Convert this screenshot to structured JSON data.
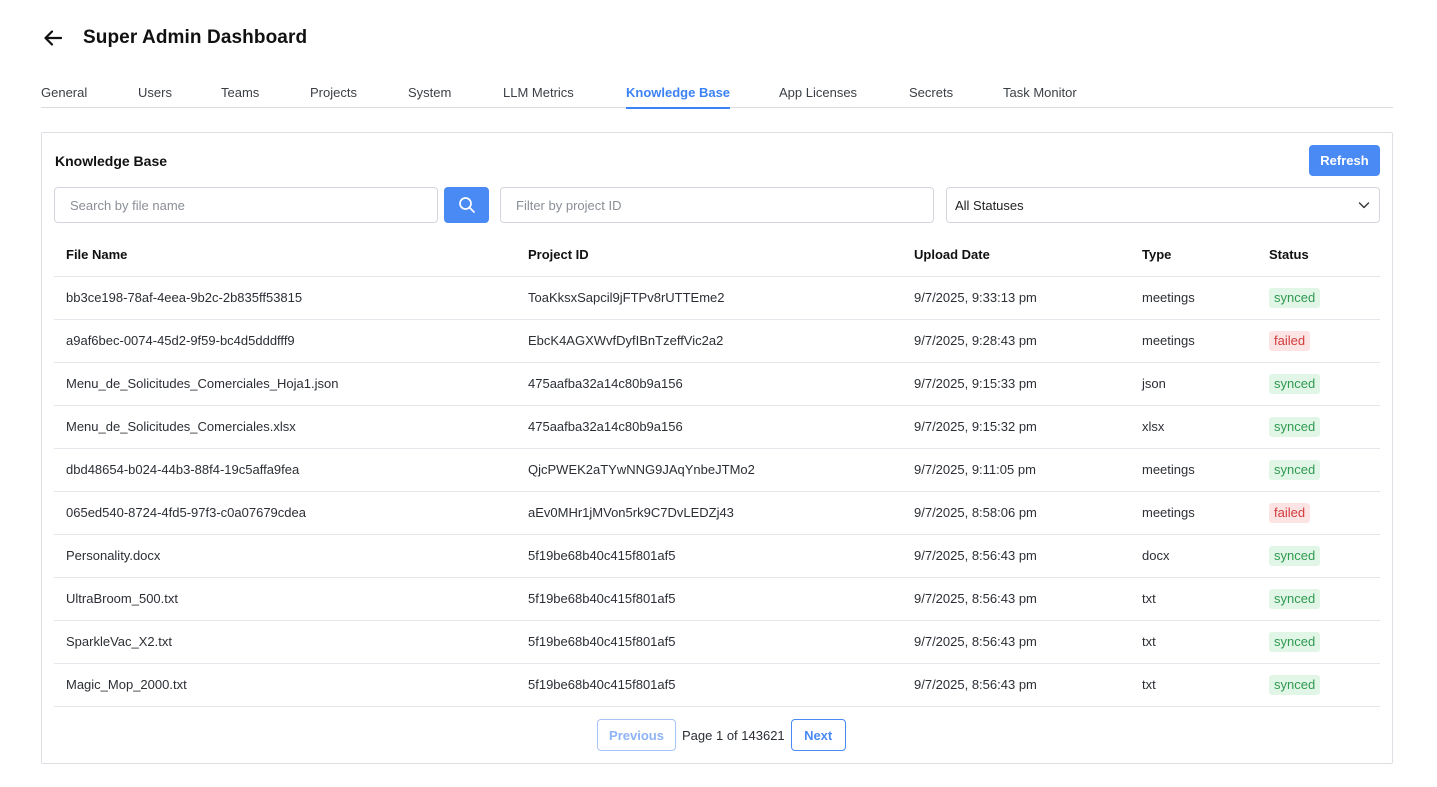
{
  "header": {
    "title": "Super Admin Dashboard"
  },
  "tabs": [
    {
      "label": "General"
    },
    {
      "label": "Users"
    },
    {
      "label": "Teams"
    },
    {
      "label": "Projects"
    },
    {
      "label": "System"
    },
    {
      "label": "LLM Metrics"
    },
    {
      "label": "Knowledge Base",
      "active": true
    },
    {
      "label": "App Licenses"
    },
    {
      "label": "Secrets"
    },
    {
      "label": "Task Monitor"
    }
  ],
  "card": {
    "title": "Knowledge Base",
    "refresh_label": "Refresh",
    "search_placeholder": "Search by file name",
    "project_placeholder": "Filter by project ID",
    "status_value": "All Statuses"
  },
  "table": {
    "columns": [
      "File Name",
      "Project ID",
      "Upload Date",
      "Type",
      "Status"
    ],
    "rows": [
      [
        "bb3ce198-78af-4eea-9b2c-2b835ff53815",
        "ToaKksxSapcil9jFTPv8rUTTEme2",
        "9/7/2025, 9:33:13 pm",
        "meetings",
        "synced"
      ],
      [
        "a9af6bec-0074-45d2-9f59-bc4d5dddfff9",
        "EbcK4AGXWvfDyfIBnTzeffVic2a2",
        "9/7/2025, 9:28:43 pm",
        "meetings",
        "failed"
      ],
      [
        "Menu_de_Solicitudes_Comerciales_Hoja1.json",
        "475aafba32a14c80b9a156",
        "9/7/2025, 9:15:33 pm",
        "json",
        "synced"
      ],
      [
        "Menu_de_Solicitudes_Comerciales.xlsx",
        "475aafba32a14c80b9a156",
        "9/7/2025, 9:15:32 pm",
        "xlsx",
        "synced"
      ],
      [
        "dbd48654-b024-44b3-88f4-19c5affa9fea",
        "QjcPWEK2aTYwNNG9JAqYnbeJTMo2",
        "9/7/2025, 9:11:05 pm",
        "meetings",
        "synced"
      ],
      [
        "065ed540-8724-4fd5-97f3-c0a07679cdea",
        "aEv0MHr1jMVon5rk9C7DvLEDZj43",
        "9/7/2025, 8:58:06 pm",
        "meetings",
        "failed"
      ],
      [
        "Personality.docx",
        "5f19be68b40c415f801af5",
        "9/7/2025, 8:56:43 pm",
        "docx",
        "synced"
      ],
      [
        "UltraBroom_500.txt",
        "5f19be68b40c415f801af5",
        "9/7/2025, 8:56:43 pm",
        "txt",
        "synced"
      ],
      [
        "SparkleVac_X2.txt",
        "5f19be68b40c415f801af5",
        "9/7/2025, 8:56:43 pm",
        "txt",
        "synced"
      ],
      [
        "Magic_Mop_2000.txt",
        "5f19be68b40c415f801af5",
        "9/7/2025, 8:56:43 pm",
        "txt",
        "synced"
      ]
    ]
  },
  "pagination": {
    "previous_label": "Previous",
    "page_info": "Page 1 of 143621",
    "next_label": "Next"
  }
}
